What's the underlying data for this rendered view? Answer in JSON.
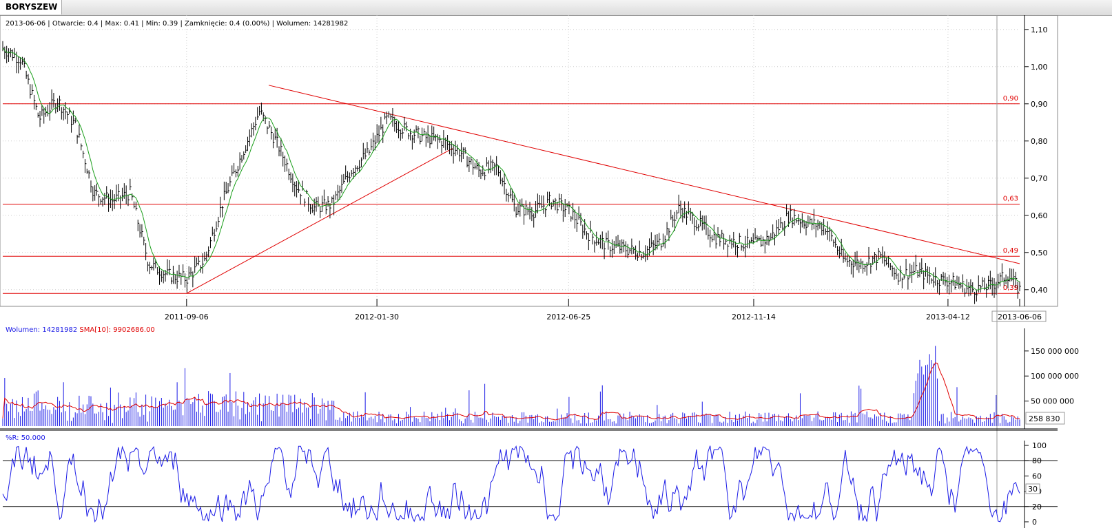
{
  "tab": {
    "label": "BORYSZEW"
  },
  "info_bar": {
    "date": "2013-06-06",
    "open": "Otwarcie: 0.4",
    "max": "Max: 0.41",
    "min": "Min: 0.39",
    "close": "Zamknięcie: 0.4 (0.00%)",
    "volume": "Wolumen: 14281982"
  },
  "colors": {
    "price_bar": "#000000",
    "sma": "#1a9e1a",
    "level": "#e00000",
    "trend": "#e00000",
    "volume": "#1a1ae6",
    "volume_sma": "#e00000",
    "wr": "#1a1ae6"
  },
  "chart_data": [
    {
      "type": "ohlc",
      "title": "BORYSZEW",
      "x_labels": [
        "2011-09-06",
        "2012-01-30",
        "2012-06-25",
        "2012-11-14",
        "2013-04-12",
        "2013-06-06"
      ],
      "y_ticks": [
        "1,10",
        "1,00",
        "0,90",
        "0,80",
        "0,70",
        "0,60",
        "0,50",
        "0,40"
      ],
      "ylim": [
        0.37,
        1.12
      ],
      "horizontal_levels": [
        {
          "value": 0.9,
          "label": "0,90"
        },
        {
          "value": 0.63,
          "label": "0,63"
        },
        {
          "value": 0.49,
          "label": "0,49"
        },
        {
          "value": 0.39,
          "label": "0,39"
        }
      ],
      "trendlines": [
        {
          "from": [
            "2011-09-06",
            0.39
          ],
          "to": [
            "2012-03-28",
            0.78
          ]
        },
        {
          "from": [
            "2011-11-08",
            0.95
          ],
          "to": [
            "2013-06-06",
            0.47
          ]
        }
      ],
      "series": [
        {
          "dates": [
            "2011-04-18",
            "2011-05-02",
            "2011-05-16",
            "2011-05-30",
            "2011-06-13",
            "2011-06-27",
            "2011-07-11",
            "2011-07-25",
            "2011-08-08",
            "2011-08-22",
            "2011-09-06",
            "2011-09-20",
            "2011-10-04",
            "2011-10-18",
            "2011-11-01",
            "2011-11-15",
            "2011-11-29",
            "2011-12-13",
            "2011-12-27",
            "2012-01-10",
            "2012-01-24",
            "2012-02-07",
            "2012-02-21",
            "2012-03-06",
            "2012-03-20",
            "2012-04-03",
            "2012-04-17",
            "2012-05-01",
            "2012-05-15",
            "2012-05-29",
            "2012-06-12",
            "2012-06-26",
            "2012-07-10",
            "2012-07-24",
            "2012-08-07",
            "2012-08-21",
            "2012-09-04",
            "2012-09-18",
            "2012-10-02",
            "2012-10-16",
            "2012-10-30",
            "2012-11-13",
            "2012-11-27",
            "2012-12-11",
            "2012-12-25",
            "2013-01-08",
            "2013-01-22",
            "2013-02-05",
            "2013-02-19",
            "2013-03-05",
            "2013-03-19",
            "2013-04-02",
            "2013-04-16",
            "2013-04-30",
            "2013-05-14",
            "2013-05-28",
            "2013-06-06"
          ],
          "close": [
            1.05,
            1.02,
            0.86,
            0.91,
            0.84,
            0.66,
            0.64,
            0.66,
            0.47,
            0.44,
            0.43,
            0.48,
            0.64,
            0.76,
            0.88,
            0.79,
            0.68,
            0.62,
            0.63,
            0.72,
            0.77,
            0.86,
            0.83,
            0.81,
            0.8,
            0.77,
            0.72,
            0.73,
            0.62,
            0.61,
            0.64,
            0.61,
            0.55,
            0.52,
            0.51,
            0.5,
            0.53,
            0.62,
            0.58,
            0.54,
            0.53,
            0.52,
            0.54,
            0.6,
            0.58,
            0.57,
            0.48,
            0.47,
            0.49,
            0.44,
            0.45,
            0.43,
            0.42,
            0.4,
            0.41,
            0.44,
            0.4
          ],
          "name": ""
        }
      ]
    },
    {
      "type": "bar",
      "legend": [
        "Wolumen: 14281982",
        "SMA[10]: 9902686.00"
      ],
      "y_ticks": [
        "150 000 000",
        "100 000 000",
        "50 000 000"
      ],
      "last_value_label": "258 830",
      "ylim": [
        0,
        180000000
      ]
    },
    {
      "type": "line",
      "legend": "%R: 50.000",
      "y_ticks": [
        "100",
        "80",
        "60",
        "40",
        "20",
        "0"
      ],
      "levels": [
        80,
        20
      ],
      "last_value_label": "30",
      "ylim": [
        0,
        100
      ]
    }
  ]
}
